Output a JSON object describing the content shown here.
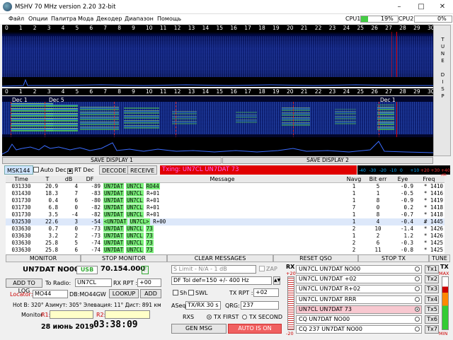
{
  "titlebar": {
    "title": "MSHV 70 MHz version 2.20 32-bit"
  },
  "menu": [
    "Файл",
    "Опции",
    "Палитра",
    "Мода",
    "Декодер",
    "Диапазон",
    "Помощь"
  ],
  "cpu": [
    {
      "label": "CPU1:",
      "pct": "19%",
      "value": 0.19
    },
    {
      "label": "CPU2:",
      "pct": "0%",
      "value": 0.0
    }
  ],
  "scale_labels": [
    "0",
    "1",
    "2",
    "3",
    "4",
    "5",
    "6",
    "7",
    "8",
    "9",
    "10",
    "11",
    "12",
    "13",
    "14",
    "15",
    "16",
    "17",
    "18",
    "19",
    "20",
    "21",
    "22",
    "23",
    "24",
    "25",
    "26",
    "27",
    "28",
    "29",
    "30"
  ],
  "side_labels": [
    "T",
    "U",
    "N",
    "E",
    "",
    "D",
    "I",
    "S",
    "P"
  ],
  "decode_marks": [
    "Dec 1",
    "Dec 5",
    "Dec 1"
  ],
  "save_display": [
    "SAVE DISPLAY 1",
    "SAVE DISPLAY 2"
  ],
  "mode": {
    "mode": "MSK144",
    "auto_dec": "Auto Dec",
    "rt_dec": "RT Dec",
    "decode": "DECODE",
    "receive": "RECEIVE",
    "txing": "Txing: UN7CL UN7DAT 73"
  },
  "db_scale": [
    "-40",
    "-30",
    "-20",
    "-10",
    "0",
    "+10",
    "+20",
    "+30",
    "+40 dB"
  ],
  "table": {
    "headers": [
      "Time",
      "T",
      "dB",
      "DF",
      "Message",
      "Navg",
      "Bit err",
      "Eye",
      "Freq"
    ],
    "rows": [
      {
        "time": "031330",
        "t": "20.9",
        "db": "4",
        "df": "-89",
        "call1": "UN7DAT",
        "call2": "UN7CL",
        "rest": "RO44",
        "navg": "1",
        "biterr": "5",
        "eye": "-0.9",
        "freq": "* 1410"
      },
      {
        "time": "031430",
        "t": "18.3",
        "db": "7",
        "df": "-83",
        "call1": "UN7DAT",
        "call2": "UN7CL",
        "rest": "R+01",
        "navg": "1",
        "biterr": "1",
        "eye": "-0.5",
        "freq": "* 1416"
      },
      {
        "time": "031730",
        "t": "0.4",
        "db": "6",
        "df": "-80",
        "call1": "UN7DAT",
        "call2": "UN7CL",
        "rest": "R+01",
        "navg": "1",
        "biterr": "8",
        "eye": "-0.9",
        "freq": "* 1419"
      },
      {
        "time": "031730",
        "t": "6.8",
        "db": "0",
        "df": "-82",
        "call1": "UN7DAT",
        "call2": "UN7CL",
        "rest": "R+01",
        "navg": "7",
        "biterr": "0",
        "eye": "0.2",
        "freq": "* 1418"
      },
      {
        "time": "031730",
        "t": "3.5",
        "db": "-4",
        "df": "-82",
        "call1": "UN7DAT",
        "call2": "UN7CL",
        "rest": "R+01",
        "navg": "1",
        "biterr": "8",
        "eye": "-0.7",
        "freq": "* 1418"
      },
      {
        "time": "032530",
        "t": "22.6",
        "db": "3",
        "df": "-54",
        "call1": "<UN7DAT",
        "call2": "UN7CL>",
        "rest": "R+00",
        "navg": "1",
        "biterr": "4",
        "eye": "-0.4",
        "freq": "# 1445"
      },
      {
        "time": "033630",
        "t": "0.7",
        "db": "0",
        "df": "-73",
        "call1": "UN7DAT",
        "call2": "UN7CL",
        "rest": "73",
        "navg": "2",
        "biterr": "10",
        "eye": "-1.4",
        "freq": "* 1426"
      },
      {
        "time": "033630",
        "t": "3.2",
        "db": "2",
        "df": "-73",
        "call1": "UN7DAT",
        "call2": "UN7CL",
        "rest": "73",
        "navg": "1",
        "biterr": "2",
        "eye": "1.2",
        "freq": "* 1426"
      },
      {
        "time": "033630",
        "t": "25.8",
        "db": "5",
        "df": "-74",
        "call1": "UN7DAT",
        "call2": "UN7CL",
        "rest": "73",
        "navg": "2",
        "biterr": "6",
        "eye": "-0.3",
        "freq": "* 1425"
      },
      {
        "time": "033630",
        "t": "25.8",
        "db": "6",
        "df": "-74",
        "call1": "UN7DAT",
        "call2": "UN7CL",
        "rest": "73",
        "navg": "2",
        "biterr": "11",
        "eye": "-0.8",
        "freq": "* 1425"
      }
    ]
  },
  "buttons": {
    "monitor": "MONITOR",
    "stop_monitor": "STOP MONITOR",
    "clear": "CLEAR MESSAGES",
    "reset_qso": "RESET QSO",
    "stop_tx": "STOP TX",
    "tune": "TUNE"
  },
  "left": {
    "my_call": "UN7DAT NO00",
    "band": "USB",
    "freq": "70.154.000",
    "f": "F",
    "add_log": "ADD TO LOG",
    "to_radio_label": "To Radio:",
    "to_radio": "UN7CL",
    "rx_rpt_label": "RX RPT :",
    "rx_rpt": "+00",
    "locator_label": "Locator:",
    "locator": "MO44",
    "locator2": "DB:MO44GW",
    "lookup": "LOOKUP",
    "add": "ADD",
    "info": "Hot B: 320°  Азимут: 305°  Элевация: 11°  Дист: 891 км",
    "monitor_label": "Monitor",
    "r1": "R1:",
    "r2": "R2:",
    "date": "28 июнь 2019",
    "time": "03:38:09"
  },
  "mid": {
    "s_limit": "S Limit - N/A - 1  dB",
    "zap": "ZAP",
    "df_tol": "DF Tol def=150 +/-  400  Hz",
    "sh": "Sh",
    "swl": "SWL",
    "tx_rpt_label": "TX RPT :",
    "tx_rpt": "+02",
    "aseq": "ASeq",
    "txrx": "TX/RX 30  s",
    "qrg_label": "QRG:",
    "qrg": "237",
    "rx_s": "RXS",
    "tx_first": "TX FIRST",
    "tx_second": "TX SECOND",
    "gen_msg": "GEN MSG",
    "auto_on": "AUTO IS ON"
  },
  "rxtx": {
    "rx": "RX",
    "tx": "TX",
    "rx_top": "+20",
    "rx_bot": "-20",
    "tx_max": "MAX",
    "tx_min": "MIN",
    "messages": [
      "UN7CL UN7DAT NO00",
      "UN7CL UN7DAT +02",
      "UN7CL UN7DAT R+02",
      "UN7CL UN7DAT RRR",
      "UN7CL UN7DAT 73",
      "CQ UN7DAT NO00",
      "CQ 237 UN7DAT NO00"
    ],
    "tx_labels": [
      "Tx1",
      "Tx2",
      "Tx3",
      "Tx4",
      "Tx5",
      "Tx6",
      "Tx7"
    ]
  }
}
